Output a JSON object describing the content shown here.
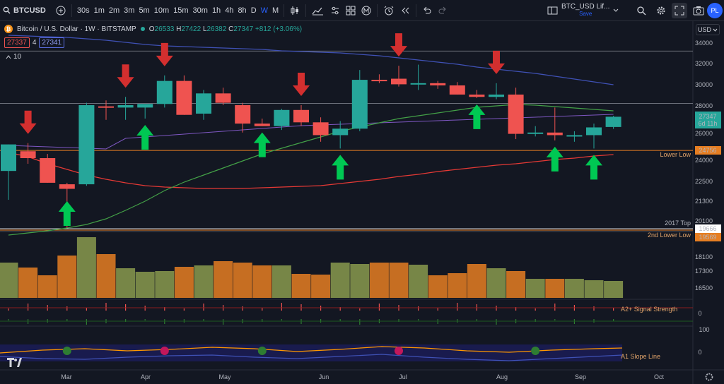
{
  "toolbar": {
    "symbol": "BTCUSD",
    "timeframes": [
      "30s",
      "1m",
      "2m",
      "3m",
      "5m",
      "10m",
      "15m",
      "30m",
      "1h",
      "4h",
      "8h",
      "D",
      "W",
      "M"
    ],
    "active_timeframe": "W",
    "layout_name": "BTC_USD Lif...",
    "save_label": "Save",
    "profile_initials": "PL"
  },
  "legend": {
    "title": "Bitcoin / U.S. Dollar · 1W · BITSTAMP",
    "open_key": "O",
    "open": "26533",
    "high_key": "H",
    "high": "27422",
    "low_key": "L",
    "low": "26382",
    "close_key": "C",
    "close": "27347",
    "change": "+812 (+3.06%)",
    "sell_price": "27337",
    "spread": "4",
    "buy_price": "27341",
    "indicator_count": "10"
  },
  "price_axis": {
    "currency": "USD",
    "ticks": [
      "34000",
      "32000",
      "30000",
      "28000",
      "26000",
      "24000",
      "22500",
      "21300",
      "20100",
      "18100",
      "17300",
      "16500"
    ],
    "current_price": "27347",
    "countdown": "6d 11h",
    "lower_low_price": "24756",
    "top_2017_price": "19666",
    "second_lower_low_price": "19569"
  },
  "levels": {
    "lower_low": "Lower Low",
    "top_2017": "2017 Top",
    "second_lower_low": "2nd Lower Low"
  },
  "indicators": {
    "signal_strength": "A2+ Signal Strength",
    "signal_axis_zero": "0",
    "signal_axis_100": "100",
    "slope_line": "A1 Slope Line",
    "slope_axis_zero": "0"
  },
  "time_axis": [
    "Mar",
    "Apr",
    "May",
    "Jun",
    "Jul",
    "Aug",
    "Sep",
    "Oct"
  ],
  "colors": {
    "up": "#26a69a",
    "down": "#ef5350",
    "arrow_up": "#00c853",
    "arrow_down": "#d32f2f",
    "ma_red": "#e53935",
    "ma_green": "#43a047",
    "ma_blue": "#3f51b5",
    "ma_purple": "#7e57c2",
    "level": "#e67e22",
    "volume_orange": "#e67e22",
    "volume_olive": "#8a9a4e"
  },
  "chart_data": {
    "type": "candlestick",
    "interval": "1W",
    "y_scale": "log",
    "candles": [
      {
        "o": 23300,
        "h": 25200,
        "l": 21400,
        "c": 25200
      },
      {
        "o": 24700,
        "h": 25300,
        "l": 23800,
        "c": 24200
      },
      {
        "o": 24200,
        "h": 24500,
        "l": 22500,
        "c": 22500
      },
      {
        "o": 22400,
        "h": 22500,
        "l": 19700,
        "c": 22100
      },
      {
        "o": 22400,
        "h": 28500,
        "l": 22300,
        "c": 28300
      },
      {
        "o": 28200,
        "h": 28700,
        "l": 27100,
        "c": 28100
      },
      {
        "o": 28100,
        "h": 29000,
        "l": 27100,
        "c": 28300
      },
      {
        "o": 28100,
        "h": 28300,
        "l": 27200,
        "c": 28400
      },
      {
        "o": 28400,
        "h": 30900,
        "l": 28100,
        "c": 30400
      },
      {
        "o": 30400,
        "h": 30900,
        "l": 27500,
        "c": 27500
      },
      {
        "o": 27600,
        "h": 29600,
        "l": 27100,
        "c": 29300
      },
      {
        "o": 29300,
        "h": 29800,
        "l": 28300,
        "c": 28500
      },
      {
        "o": 28300,
        "h": 28500,
        "l": 26100,
        "c": 26800
      },
      {
        "o": 26800,
        "h": 27200,
        "l": 26600,
        "c": 26600
      },
      {
        "o": 26600,
        "h": 28000,
        "l": 26300,
        "c": 27900
      },
      {
        "o": 27900,
        "h": 28300,
        "l": 26600,
        "c": 26900
      },
      {
        "o": 26900,
        "h": 27300,
        "l": 25400,
        "c": 25900
      },
      {
        "o": 25900,
        "h": 27000,
        "l": 24900,
        "c": 26400
      },
      {
        "o": 26400,
        "h": 31400,
        "l": 26200,
        "c": 30500
      },
      {
        "o": 30500,
        "h": 31000,
        "l": 30200,
        "c": 30400
      },
      {
        "o": 30600,
        "h": 31800,
        "l": 29900,
        "c": 30100
      },
      {
        "o": 30200,
        "h": 31900,
        "l": 29600,
        "c": 30200
      },
      {
        "o": 30200,
        "h": 30400,
        "l": 29700,
        "c": 30000
      },
      {
        "o": 30000,
        "h": 30300,
        "l": 29200,
        "c": 29200
      },
      {
        "o": 29200,
        "h": 29600,
        "l": 28900,
        "c": 29000
      },
      {
        "o": 29000,
        "h": 30200,
        "l": 28800,
        "c": 29200
      },
      {
        "o": 29200,
        "h": 29800,
        "l": 25600,
        "c": 26000
      },
      {
        "o": 26000,
        "h": 26600,
        "l": 25800,
        "c": 26100
      },
      {
        "o": 26100,
        "h": 28100,
        "l": 25500,
        "c": 25900
      },
      {
        "o": 25800,
        "h": 26200,
        "l": 25400,
        "c": 25900
      },
      {
        "o": 25900,
        "h": 26800,
        "l": 24900,
        "c": 26500
      },
      {
        "o": 26533,
        "h": 27422,
        "l": 26382,
        "c": 27347
      }
    ],
    "horizontal_levels": [
      {
        "price": 33200
      },
      {
        "price": 28450
      },
      {
        "price": 24756,
        "label": "Lower Low"
      },
      {
        "price": 19666,
        "label": "2017 Top"
      },
      {
        "price": 19569,
        "label": "2nd Lower Low"
      }
    ],
    "sell_signals_candle_index": [
      1,
      6,
      8,
      15,
      20,
      25
    ],
    "buy_signals_candle_index": [
      3,
      7,
      13,
      17,
      24,
      28,
      30
    ],
    "volume_relative": [
      0.5,
      0.43,
      0.32,
      0.6,
      0.86,
      0.62,
      0.42,
      0.37,
      0.38,
      0.44,
      0.46,
      0.52,
      0.5,
      0.46,
      0.46,
      0.34,
      0.33,
      0.5,
      0.48,
      0.5,
      0.5,
      0.47,
      0.32,
      0.35,
      0.48,
      0.42,
      0.38,
      0.27,
      0.27,
      0.27,
      0.25,
      0.24
    ],
    "signal_dots": [
      {
        "candle_index": 3,
        "color": "green"
      },
      {
        "candle_index": 8,
        "color": "red"
      },
      {
        "candle_index": 13,
        "color": "green"
      },
      {
        "candle_index": 20,
        "color": "red"
      },
      {
        "candle_index": 27,
        "color": "green"
      }
    ]
  }
}
